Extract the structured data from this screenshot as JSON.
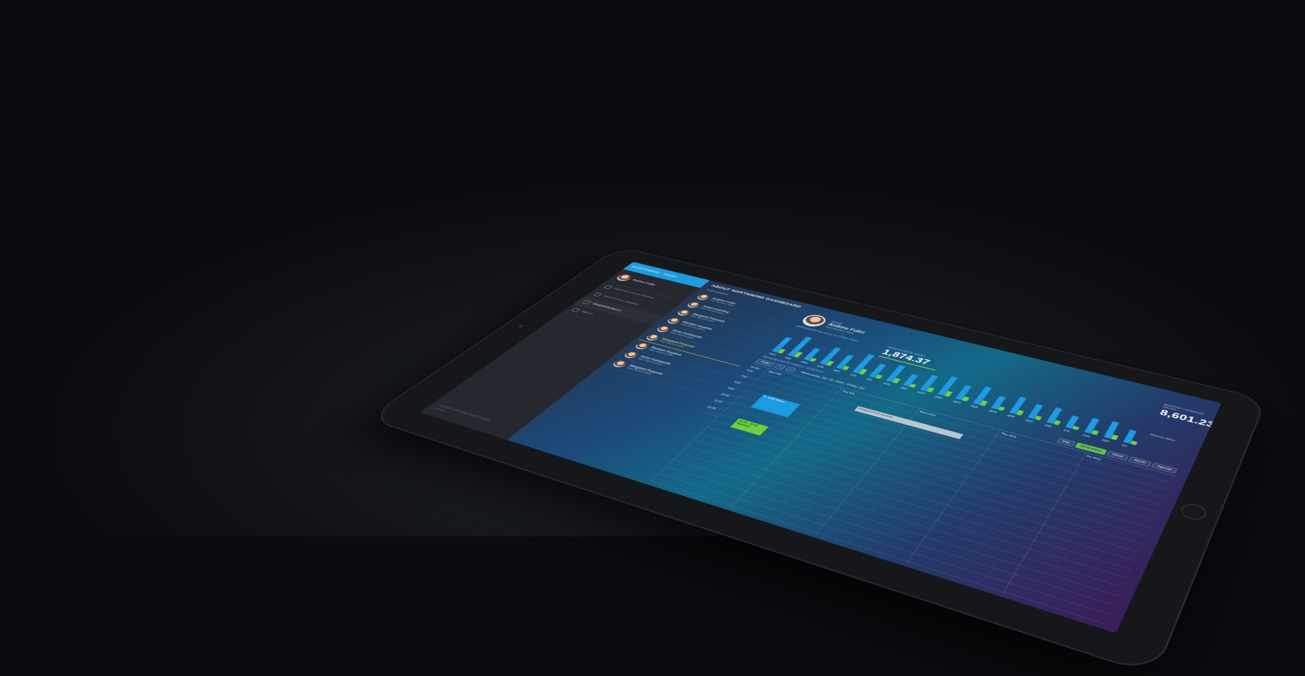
{
  "drawer": {
    "title": "NORTHWIND · DASH",
    "user": {
      "name": "Andrew Fuller"
    },
    "nav": [
      {
        "label": "REGIONAL SALES STATUS",
        "active": false
      },
      {
        "label": "PRODUCTS & ORDERS",
        "active": false
      },
      {
        "label": "TEAM EFFICIENCY",
        "active": true
      },
      {
        "label": "ABOUT",
        "active": false
      }
    ],
    "copyright": "Copyright © 2013-2015 Telerik. All rights reserved."
  },
  "main": {
    "title": "ABOUT NORTHWIND DASHBOARD",
    "employees_caption": "TEAM MEMBERS",
    "employees": [
      {
        "name": "Andrew Fuller",
        "role": "Vice President, Sales",
        "selected": false
      },
      {
        "name": "Janet Leverling",
        "role": "Sales Representative",
        "selected": false
      },
      {
        "name": "Margaret Peacock",
        "role": "Sales Representative",
        "selected": false
      },
      {
        "name": "Michael Suyama",
        "role": "Sales Representative",
        "selected": false
      },
      {
        "name": "Anne Dodsworth",
        "role": "Sales Representative",
        "selected": false
      },
      {
        "name": "Margaret Peacock",
        "role": "Sales Representative",
        "selected": true
      },
      {
        "name": "Michael Suyama",
        "role": "Sales Representative",
        "selected": false
      },
      {
        "name": "Anne Dodsworth",
        "role": "Sales Representative",
        "selected": false
      },
      {
        "name": "Margaret Peacock",
        "role": "Sales Representative",
        "selected": false
      }
    ],
    "owner": {
      "label": "GROUP",
      "name": "Andrew Fuller",
      "title": "Vice President, Sales"
    },
    "kpi_ytd": {
      "label": "YEAR-TO-DATE SALES",
      "value": "1,874.37"
    },
    "kpi_month": {
      "label": "MONTHLY AVERAGE SALES",
      "value": "8,601.23"
    },
    "chart_caption": "REPRESENTATIVE SALES VS. TOTAL SALES",
    "spark_legend": "Representative",
    "schedule": {
      "caption": "REPRESENTATIVE ORDERS - SCHEDULE",
      "today": "Today",
      "prev": "‹",
      "next": "›",
      "range": "Wednesday, Apr 10, 2013 - Friday, Apr",
      "views": [
        "Day",
        "Work Week",
        "Week",
        "Month",
        "Agenda"
      ],
      "active_view": "Work Week",
      "all_day": "all day",
      "days": [
        "Mon 4/8",
        "Tue 4/9",
        "Wed 4/10",
        "Thu 4/11",
        "Fri 4/12"
      ],
      "times": [
        "6:00",
        "7:00",
        "8:00",
        "9:00",
        "10:00",
        "11:00",
        "12:00"
      ],
      "events": {
        "scrum": "9 - 9:30 Scrum",
        "vacation": "Margaret is on vacation",
        "business": "11:30 - 12:30 Business"
      }
    }
  },
  "chart_data": {
    "type": "bar",
    "categories": [
      "2014",
      "FEB",
      "MAR",
      "APR",
      "MAY",
      "JUN",
      "JUL",
      "AUG",
      "SEP",
      "NOV",
      "DEC",
      "2015",
      "FEB",
      "MAR",
      "APR",
      "MAY",
      "JUN",
      "JUL",
      "AUG",
      "SEP",
      "OC"
    ],
    "series": [
      {
        "name": "Total",
        "values": [
          70,
          92,
          55,
          78,
          62,
          85,
          58,
          72,
          50,
          66,
          80,
          60,
          74,
          52,
          68,
          56,
          62,
          48,
          58,
          64,
          50
        ]
      },
      {
        "name": "Representative",
        "values": [
          18,
          24,
          14,
          20,
          16,
          22,
          15,
          19,
          13,
          17,
          21,
          16,
          19,
          13,
          18,
          14,
          16,
          12,
          15,
          17,
          13
        ]
      }
    ],
    "colors": {
      "total": "#1e9be3",
      "representative": "#6fd04a"
    },
    "ylim": [
      0,
      100
    ]
  }
}
